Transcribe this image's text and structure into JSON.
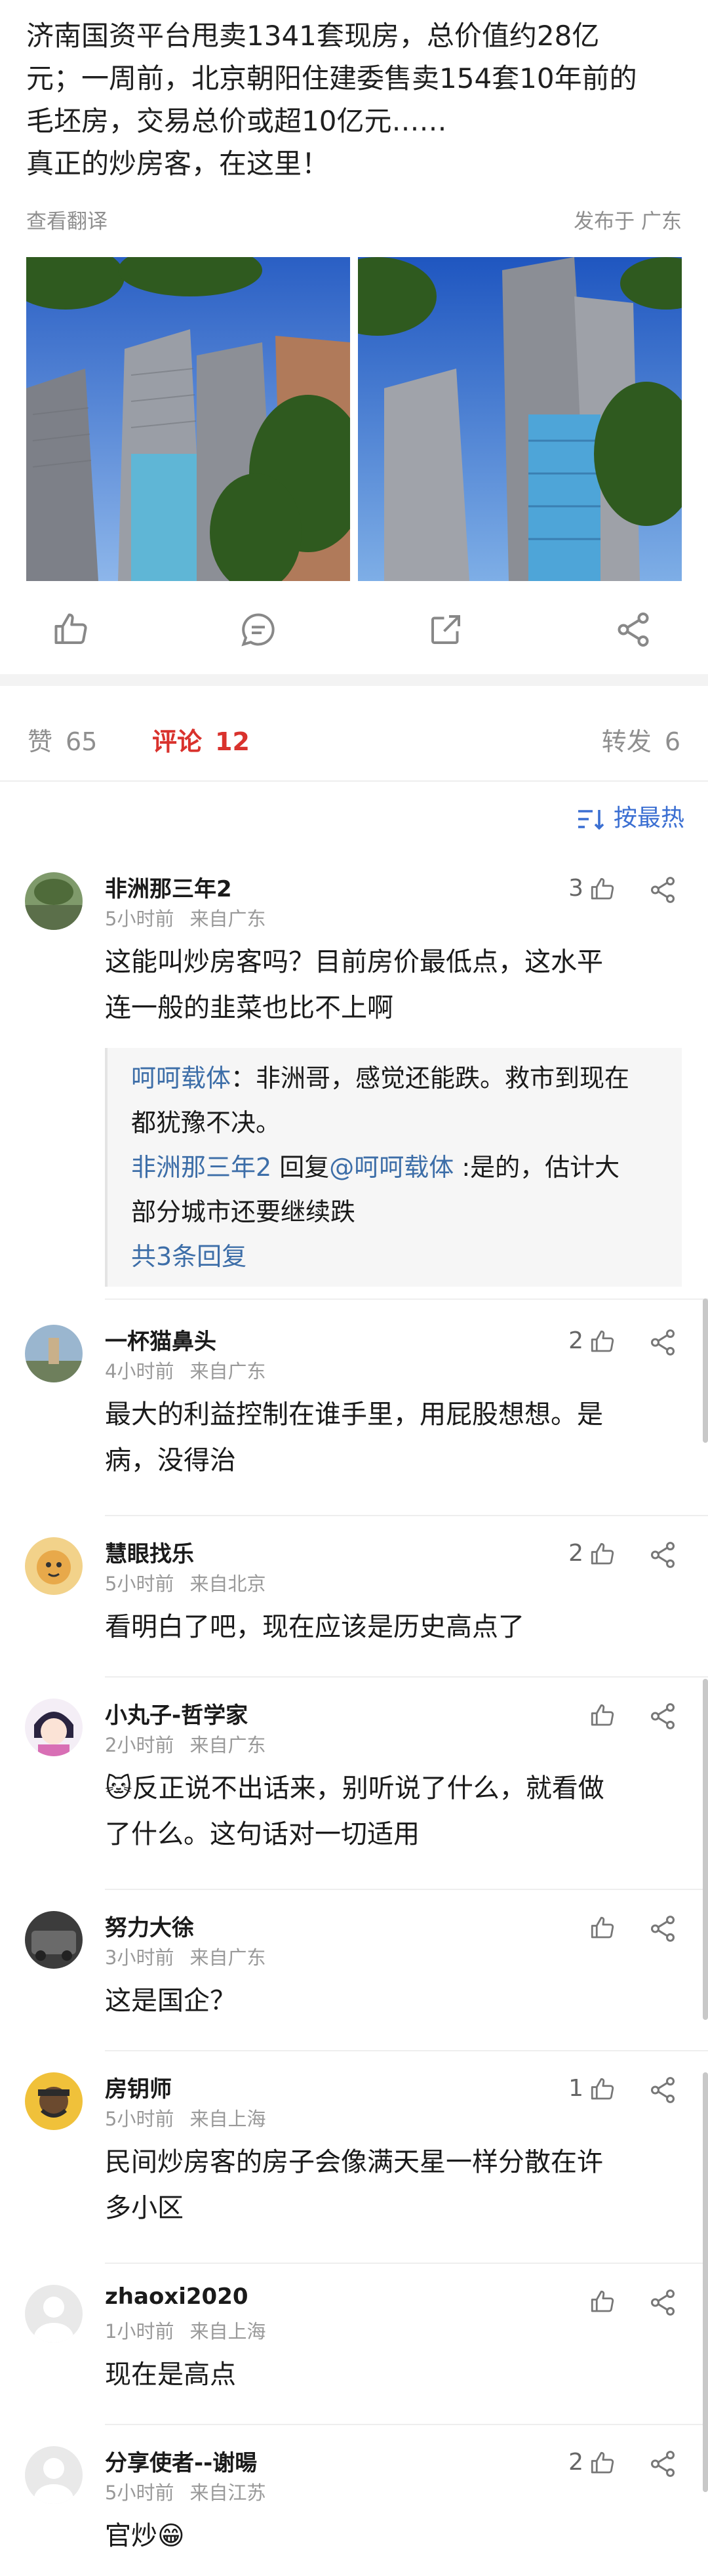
{
  "post": {
    "lines": [
      "济南国资平台甩卖1341套现房，总价值约28亿",
      "元；一周前，北京朝阳住建委售卖154套10年前的",
      "毛坯房，交易总价或超10亿元……",
      "真正的炒房客，在这里！"
    ],
    "translate": "查看翻译",
    "published": "发布于 广东"
  },
  "stats": {
    "like_label": "赞",
    "like_count": "65",
    "comment_label": "评论",
    "comment_count": "12",
    "repost_label": "转发",
    "repost_count": "6"
  },
  "sort_label": "按最热",
  "comments": [
    {
      "user": "非洲那三年2",
      "time": "5小时前",
      "from": "来自广东",
      "likes": "3",
      "text": [
        "这能叫炒房客吗？目前房价最低点，这水平",
        "连一般的韭菜也比不上啊"
      ],
      "replies": {
        "r1_name": "呵呵载体",
        "r1_text": "：非洲哥，感觉还能跌。救市到现在",
        "r1_text2": "都犹豫不决。",
        "r2_name": "非洲那三年2",
        "r2_mid": " 回复",
        "r2_at": "@呵呵载体",
        "r2_text": " :是的，估计大",
        "r2_text2": "部分城市还要继续跌",
        "more": "共3条回复"
      }
    },
    {
      "user": "一杯猫鼻头",
      "time": "4小时前",
      "from": "来自广东",
      "likes": "2",
      "text": [
        "最大的利益控制在谁手里，用屁股想想。是",
        "病，没得治"
      ]
    },
    {
      "user": "慧眼找乐",
      "time": "5小时前",
      "from": "来自北京",
      "likes": "2",
      "text": [
        "看明白了吧，现在应该是历史高点了"
      ]
    },
    {
      "user": "小丸子-哲学家",
      "time": "2小时前",
      "from": "来自广东",
      "likes": "",
      "text": [
        "🐱反正说不出话来，别听说了什么，就看做",
        "了什么。这句话对一切适用"
      ]
    },
    {
      "user": "努力大徐",
      "time": "3小时前",
      "from": "来自广东",
      "likes": "",
      "text": [
        "这是国企？"
      ]
    },
    {
      "user": "房钥师",
      "time": "5小时前",
      "from": "来自上海",
      "likes": "1",
      "text": [
        "民间炒房客的房子会像满天星一样分散在许",
        "多小区"
      ]
    },
    {
      "user": "zhaoxi2020",
      "time": "1小时前",
      "from": "来自上海",
      "likes": "",
      "text": [
        "现在是高点"
      ]
    },
    {
      "user": "分享使者--谢暘",
      "time": "5小时前",
      "from": "来自江苏",
      "likes": "2",
      "text": [
        "官炒😁"
      ]
    }
  ],
  "colors": {
    "accent_red": "#d9322d",
    "link_blue": "#3d6ea8",
    "sort_blue": "#3b6fd2"
  },
  "icons": [
    "thumb-up-icon",
    "comment-icon",
    "repost-icon",
    "share-icon",
    "sort-icon"
  ]
}
